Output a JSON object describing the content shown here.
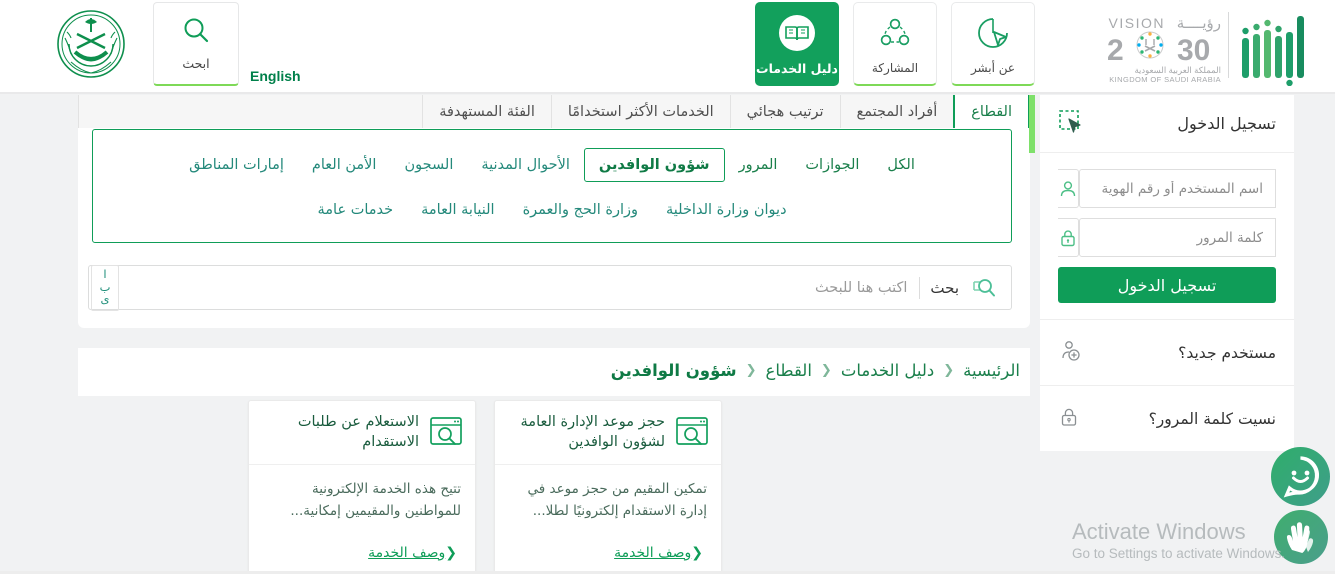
{
  "header": {
    "moi_logo_alt": "moi-emblem",
    "search_button": {
      "label": "ابحث",
      "icon": "search-icon"
    },
    "english_link": "English",
    "nav_buttons": [
      {
        "id": "services",
        "label": "دليل الخدمات",
        "icon": "book-icon",
        "active": true
      },
      {
        "id": "participate",
        "label": "المشاركة",
        "icon": "share-nodes-icon",
        "active": false
      },
      {
        "id": "about",
        "label": "عن أبشر",
        "icon": "cursor-pie-icon",
        "active": false
      }
    ],
    "vision_logo": {
      "word_en": "VISION",
      "word_ar": "رؤيــــة",
      "year": "2030",
      "kingdom_ar": "المملكة العربية السعودية",
      "kingdom_en": "KINGDOM OF SAUDI ARABIA"
    },
    "absher_logo_alt": "absher-logo"
  },
  "tabs": [
    {
      "label": "القطاع",
      "active": true
    },
    {
      "label": "أفراد المجتمع",
      "active": false
    },
    {
      "label": "ترتيب هجائي",
      "active": false
    },
    {
      "label": "الخدمات الأكثر استخدامًا",
      "active": false
    },
    {
      "label": "الفئة المستهدفة",
      "active": false
    }
  ],
  "filters": {
    "row1": [
      {
        "label": "الكل",
        "selected": false,
        "tone": "green"
      },
      {
        "label": "الجوازات",
        "selected": false,
        "tone": "green"
      },
      {
        "label": "المرور",
        "selected": false,
        "tone": "green"
      },
      {
        "label": "شؤون الوافدين",
        "selected": true,
        "tone": "green"
      },
      {
        "label": "الأحوال المدنية",
        "selected": false,
        "tone": "teal"
      },
      {
        "label": "السجون",
        "selected": false,
        "tone": "teal"
      },
      {
        "label": "الأمن العام",
        "selected": false,
        "tone": "teal"
      },
      {
        "label": "إمارات المناطق",
        "selected": false,
        "tone": "teal"
      }
    ],
    "row2": [
      {
        "label": "ديوان وزارة الداخلية",
        "selected": false,
        "tone": "teal"
      },
      {
        "label": "وزارة الحج والعمرة",
        "selected": false,
        "tone": "teal"
      },
      {
        "label": "النيابة العامة",
        "selected": false,
        "tone": "teal"
      },
      {
        "label": "خدمات عامة",
        "selected": false,
        "tone": "teal"
      }
    ]
  },
  "search": {
    "icon": "search-icon",
    "label": "بحث",
    "value": "",
    "placeholder": "اكتب هنا للبحث",
    "alphabet_letters": [
      "ا",
      "ب",
      "ى"
    ]
  },
  "breadcrumb": [
    {
      "label": "الرئيسية",
      "current": false
    },
    {
      "label": "دليل الخدمات",
      "current": false
    },
    {
      "label": "القطاع",
      "current": false
    },
    {
      "label": "شؤون الوافدين",
      "current": true
    }
  ],
  "breadcrumb_separator": "❮",
  "cards": [
    {
      "title": "حجز موعد الإدارة العامة لشؤون الوافدين",
      "icon": "window-search-icon",
      "description": "تمكين المقيم من حجز موعد في إدارة الاستقدام إلكترونيًا لطلا...",
      "link_label": "وصف الخدمة",
      "link_chevron": "❮"
    },
    {
      "title": "الاستعلام عن طلبات الاستقدام",
      "icon": "window-search-icon",
      "description": "تتيح هذه الخدمة الإلكترونية للمواطنين والمقيمين إمكانية...",
      "link_label": "وصف الخدمة",
      "link_chevron": "❮"
    }
  ],
  "login": {
    "title": "تسجيل الدخول",
    "title_icon": "cursor-select-icon",
    "username": {
      "value": "",
      "placeholder": "اسم المستخدم أو رقم الهوية",
      "icon": "user-icon"
    },
    "password": {
      "value": "",
      "placeholder": "كلمة المرور",
      "icon": "lock-icon"
    },
    "submit_label": "تسجيل الدخول",
    "links": [
      {
        "label": "مستخدم جديد؟",
        "icon": "user-add-icon"
      },
      {
        "label": "نسيت كلمة المرور؟",
        "icon": "lock-icon"
      }
    ]
  },
  "floating": [
    {
      "id": "chat",
      "icon": "chatbot-smiley-icon"
    },
    {
      "id": "sign-language",
      "icon": "sign-language-hands-icon"
    }
  ],
  "watermark": {
    "line1": "Activate Windows",
    "line2": "Go to Settings to activate Windows."
  },
  "colors": {
    "brand_green": "#0f9d58",
    "dark_green": "#12a05c",
    "teal": "#24897b",
    "accent_light_green": "#7ee06a",
    "page_bg": "#f1f2f3"
  }
}
